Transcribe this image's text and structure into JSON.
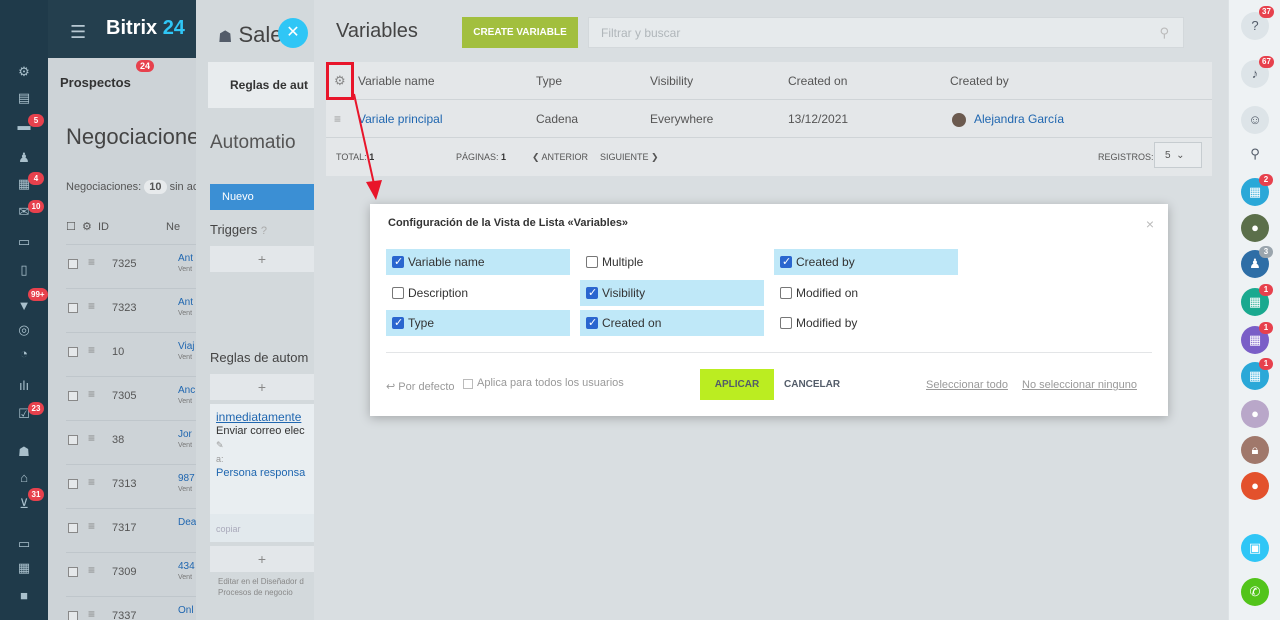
{
  "header": {
    "brand": "Bitrix",
    "brand_num": "24"
  },
  "leftbar": {
    "badges": [
      "5",
      "4",
      "10",
      "99+",
      "23",
      "31"
    ]
  },
  "crm": {
    "tab_label": "Prospectos",
    "tab_badge": "24",
    "page_title": "Negociaciones",
    "subtitle_prefix": "Negociaciones:",
    "count": "10",
    "subtitle_suffix": "sin ac",
    "col_id": "ID",
    "col_name": "Ne",
    "rows": [
      {
        "id": "7325",
        "name": "Ant",
        "sub": "Vent"
      },
      {
        "id": "7323",
        "name": "Ant",
        "sub": "Vent"
      },
      {
        "id": "10",
        "name": "Viaj",
        "sub": "Vent"
      },
      {
        "id": "7305",
        "name": "Anc",
        "sub": "Vent"
      },
      {
        "id": "38",
        "name": "Jor",
        "sub": "Vent"
      },
      {
        "id": "7313",
        "name": "987",
        "sub": "Vent"
      },
      {
        "id": "7317",
        "name": "Dea",
        "sub": ""
      },
      {
        "id": "7309",
        "name": "434",
        "sub": "Vent"
      },
      {
        "id": "7337",
        "name": "Onl",
        "sub": ""
      }
    ]
  },
  "salesbot": {
    "title": "Sale",
    "tab": "Reglas de aut",
    "heading": "Automatio",
    "new_button": "Nuevo",
    "triggers": "Triggers",
    "plus": "+",
    "rules": "Reglas de autom",
    "card": {
      "when": "inmediatamente",
      "action": "Enviar correo elec",
      "to_label": "a:",
      "person": "Persona responsa"
    },
    "copy": "copiar",
    "footer_line1": "Editar en el Diseñador d",
    "footer_line2": "Procesos de negocio"
  },
  "variables": {
    "title": "Variables",
    "create_button": "CREATE VARIABLE",
    "search_placeholder": "Filtrar y buscar",
    "columns": [
      "Variable name",
      "Type",
      "Visibility",
      "Created on",
      "Created by"
    ],
    "rows": [
      {
        "name": "Variale principal",
        "type": "Cadena",
        "visibility": "Everywhere",
        "created_on": "13/12/2021",
        "created_by": "Alejandra García"
      }
    ],
    "footer": {
      "total_label": "TOTAL:",
      "total_value": "1",
      "pages_label": "PÁGINAS:",
      "pages_value": "1",
      "prev": "❮ ANTERIOR",
      "next": "SIGUIENTE ❯",
      "records_label": "REGISTROS:",
      "records_value": "5"
    }
  },
  "modal": {
    "title": "Configuración de la Vista de Lista «Variables»",
    "options": {
      "variable_name": {
        "label": "Variable name",
        "checked": true
      },
      "description": {
        "label": "Description",
        "checked": false
      },
      "type": {
        "label": "Type",
        "checked": true
      },
      "multiple": {
        "label": "Multiple",
        "checked": false
      },
      "visibility": {
        "label": "Visibility",
        "checked": true
      },
      "created_on": {
        "label": "Created on",
        "checked": true
      },
      "created_by": {
        "label": "Created by",
        "checked": true
      },
      "modified_on": {
        "label": "Modified on",
        "checked": false
      },
      "modified_by": {
        "label": "Modified by",
        "checked": false
      }
    },
    "default_link": "↩ Por defecto",
    "all_users": "Aplica para todos los usuarios",
    "apply": "APLICAR",
    "cancel": "CANCELAR",
    "select_all": "Seleccionar todo",
    "select_none": "No seleccionar ninguno"
  },
  "rightbar": {
    "badges": [
      "37",
      "67",
      "2",
      "3",
      "1",
      "1",
      "1"
    ]
  }
}
